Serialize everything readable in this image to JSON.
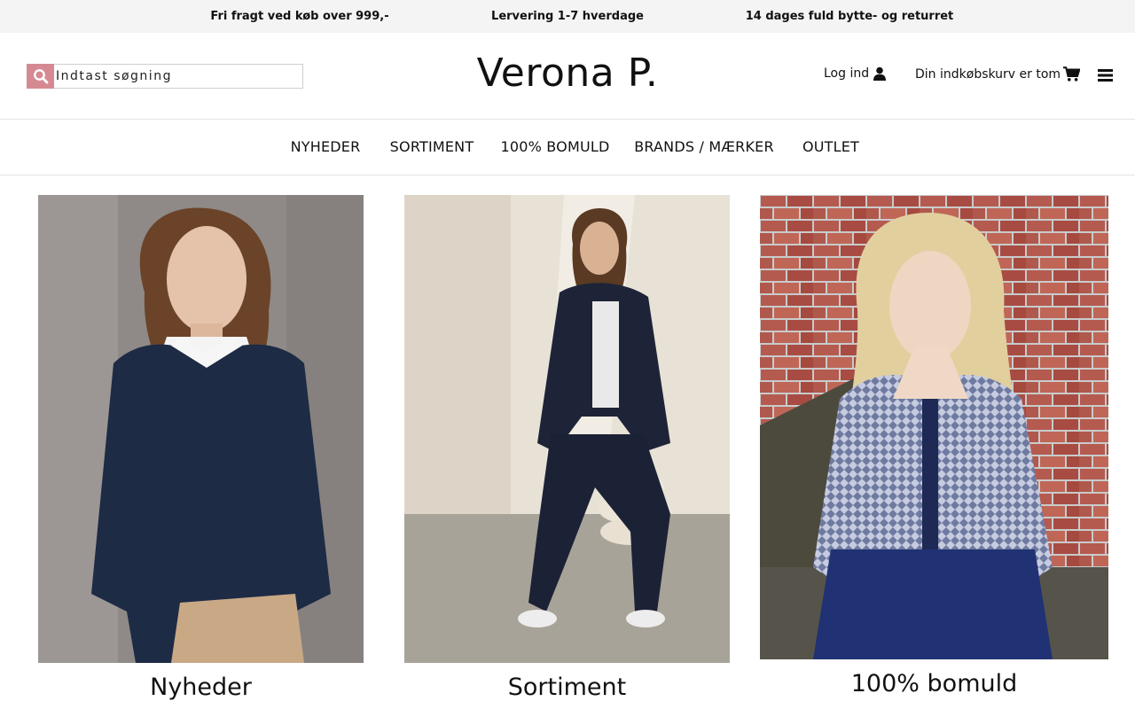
{
  "topbar": {
    "msg1": "Fri fragt ved køb over 999,-",
    "msg2": "Lervering 1-7 hverdage",
    "msg3": "14 dages fuld bytte- og returret"
  },
  "header": {
    "search_placeholder": "Indtast søgning",
    "logo": "Verona P.",
    "login_label": "Log ind",
    "cart_label": "Din indkøbskurv er tom",
    "icons": [
      "search-icon",
      "user-icon",
      "cart-icon",
      "hamburger-menu-icon"
    ],
    "accent_color": "#d58a93"
  },
  "nav": {
    "items": [
      "NYHEDER",
      "SORTIMENT",
      "100% BOMULD",
      "BRANDS / MÆRKER",
      "OUTLET"
    ]
  },
  "categories": [
    {
      "label": "Nyheder"
    },
    {
      "label": "Sortiment"
    },
    {
      "label": "100% bomuld"
    }
  ]
}
